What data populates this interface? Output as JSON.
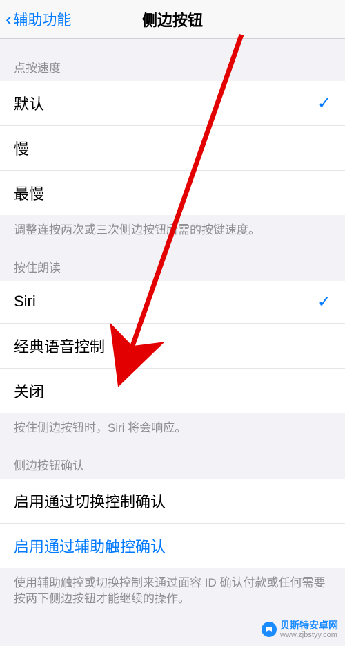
{
  "navbar": {
    "back_label": "辅助功能",
    "title": "侧边按钮"
  },
  "sections": {
    "click_speed": {
      "header": "点按速度",
      "items": [
        {
          "label": "默认",
          "selected": true
        },
        {
          "label": "慢",
          "selected": false
        },
        {
          "label": "最慢",
          "selected": false
        }
      ],
      "footer": "调整连按两次或三次侧边按钮所需的按键速度。"
    },
    "hold_speak": {
      "header": "按住朗读",
      "items": [
        {
          "label": "Siri",
          "selected": true
        },
        {
          "label": "经典语音控制",
          "selected": false
        },
        {
          "label": "关闭",
          "selected": false
        }
      ],
      "footer": "按住侧边按钮时，Siri 将会响应。"
    },
    "confirm": {
      "header": "侧边按钮确认",
      "items": [
        {
          "label": "启用通过切换控制确认",
          "link": false
        },
        {
          "label": "启用通过辅助触控确认",
          "link": true
        }
      ],
      "footer": "使用辅助触控或切换控制来通过面容 ID 确认付款或任何需要按两下侧边按钮才能继续的操作。"
    }
  },
  "watermark": {
    "name": "贝斯特安卓网",
    "url": "www.zjbstyy.com"
  }
}
